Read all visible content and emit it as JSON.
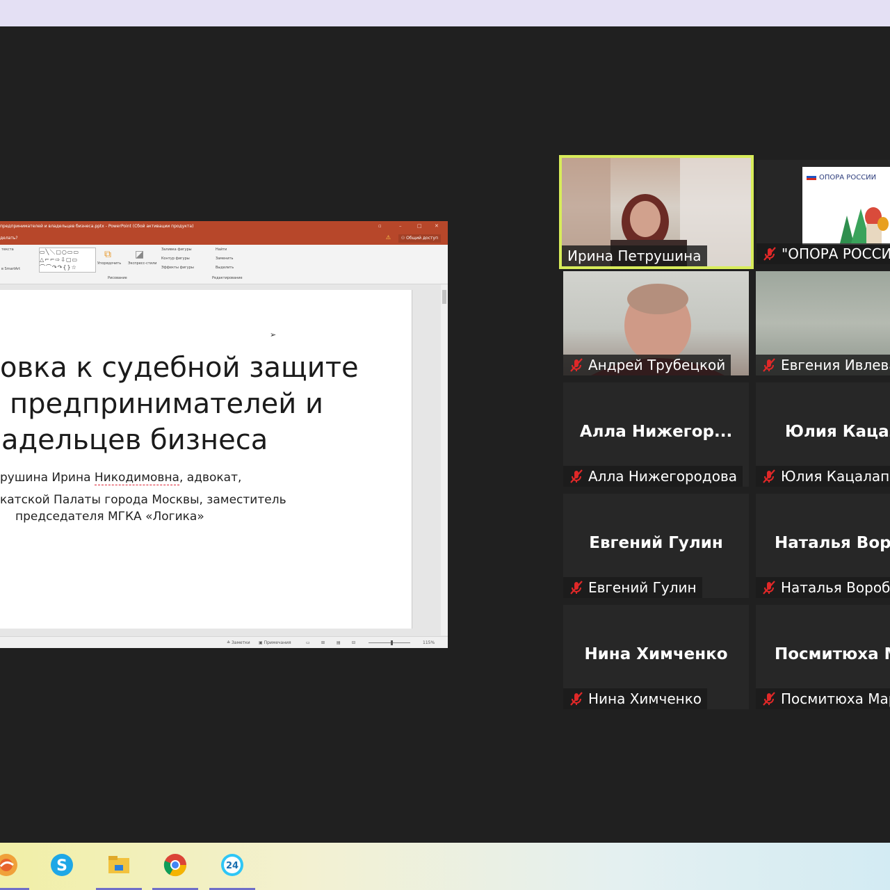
{
  "presentation": {
    "window_title": "предпринимателей и владельцев бизнеса.pptx - PowerPoint (Сбой активации продукта)",
    "menu_hint": "делать?",
    "share_label": "Общий доступ",
    "ribbon": {
      "arrange": "Упорядочить",
      "quick_styles": "Экспресс-стили",
      "fill": "Заливка фигуры",
      "outline": "Контур фигуры",
      "effects": "Эффекты фигуры",
      "find": "Найти",
      "replace": "Заменить",
      "select": "Выделить",
      "group_drawing": "Рисование",
      "group_editing": "Редактирование",
      "textbox_hint": "текста",
      "smartart_hint": "в SmartArt"
    },
    "status": {
      "notes": "Заметки",
      "comments": "Примечания",
      "zoom": "115%"
    },
    "slide": {
      "title_lines": [
        "овка к судебной защите",
        "предпринимателей и",
        "адельцев бизнеса"
      ],
      "author_prefix": "рушина Ирина ",
      "author_patronymic": "Никодимовна",
      "author_suffix": ", адвокат,",
      "affiliation_line1": "катской Палаты города Москвы, заместитель",
      "affiliation_line2": "председателя МГКА «Логика»"
    }
  },
  "participants": [
    {
      "name": "Ирина Петрушина",
      "video": true,
      "active": true,
      "muted": false
    },
    {
      "name": "\"ОПОРА РОССИ",
      "video": true,
      "muted": true,
      "logo_text": "ОПОРА РОССИИ"
    },
    {
      "name": "Андрей Трубецкой",
      "video": true,
      "muted": true
    },
    {
      "name": "Евгения Ивлева",
      "video": true,
      "muted": true
    },
    {
      "name": "Алла Нижегородова",
      "display": "Алла  Нижегор...",
      "muted": true
    },
    {
      "name": "Юлия Кацалап",
      "display": "Юлия Кацал",
      "muted": true
    },
    {
      "name": "Евгений Гулин",
      "display": "Евгений Гулин",
      "muted": true
    },
    {
      "name": "Наталья Вороби",
      "display": "Наталья  Воро",
      "muted": true
    },
    {
      "name": "Нина Химченко",
      "display": "Нина Химченко",
      "muted": true
    },
    {
      "name": "Посмитюха Мар",
      "display": "Посмитюха  М",
      "muted": true
    }
  ],
  "taskbar": {
    "apps": [
      {
        "icon": "browser-icon",
        "color": "#e8642c"
      },
      {
        "icon": "skype-icon",
        "color": "#1ea7e6"
      },
      {
        "icon": "file-explorer-icon",
        "color": "#f2c23e"
      },
      {
        "icon": "chrome-icon",
        "color": "#db4437"
      },
      {
        "icon": "bitrix24-icon",
        "color": "#2fc6f6",
        "label": "24"
      }
    ]
  },
  "colors": {
    "active_speaker_border": "#d8ec5a",
    "muted_icon": "#e02828",
    "powerpoint_accent": "#b7472a"
  }
}
